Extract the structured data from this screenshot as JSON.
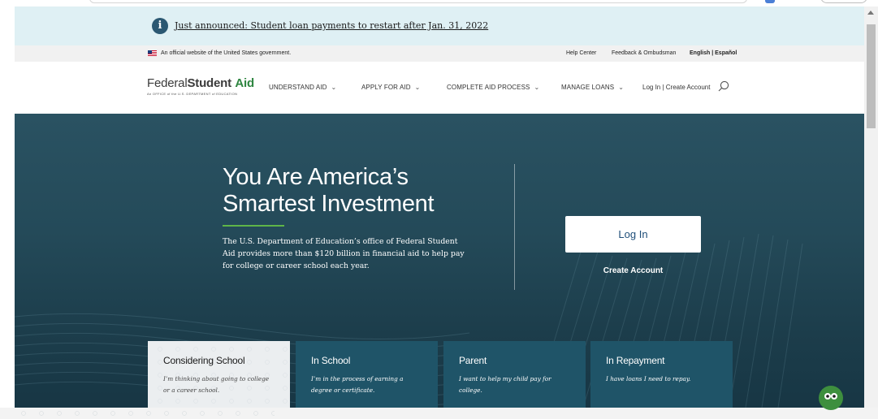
{
  "announcement": {
    "icon": "info-icon",
    "text": "Just announced: Student loan payments to restart after Jan. 31, 2022"
  },
  "official_bar": {
    "gov_text": "An official website of the United States government.",
    "help_center": "Help Center",
    "feedback": "Feedback & Ombudsman",
    "language": "English | Español"
  },
  "header": {
    "logo": {
      "part1": "Federal",
      "part2": "Student",
      "part3": "Aid",
      "tagline": "An OFFICE of the U.S. DEPARTMENT of EDUCATION"
    },
    "nav": [
      {
        "label": "UNDERSTAND AID"
      },
      {
        "label": "APPLY FOR AID"
      },
      {
        "label": "COMPLETE AID PROCESS"
      },
      {
        "label": "MANAGE LOANS"
      }
    ],
    "login_links": "Log In | Create Account"
  },
  "hero": {
    "title": "You Are America’s Smartest Investment",
    "description": "The U.S. Department of Education’s office of Federal Student Aid provides more than $120 billion in financial aid to help pay for college or career school each year.",
    "login_button": "Log In",
    "create_account": "Create Account"
  },
  "cards": [
    {
      "title": "Considering School",
      "subtitle": "I’m thinking about going to college or a career school."
    },
    {
      "title": "In School",
      "subtitle": "I’m in the process of earning a degree or certificate."
    },
    {
      "title": "Parent",
      "subtitle": "I want to help my child pay for college."
    },
    {
      "title": "In Repayment",
      "subtitle": "I have loans I need to repay."
    }
  ],
  "colors": {
    "hero_bg": "#244a59",
    "card_bg": "#1f5468",
    "accent_green": "#5fb548",
    "announce_bg": "#dff0f4"
  }
}
